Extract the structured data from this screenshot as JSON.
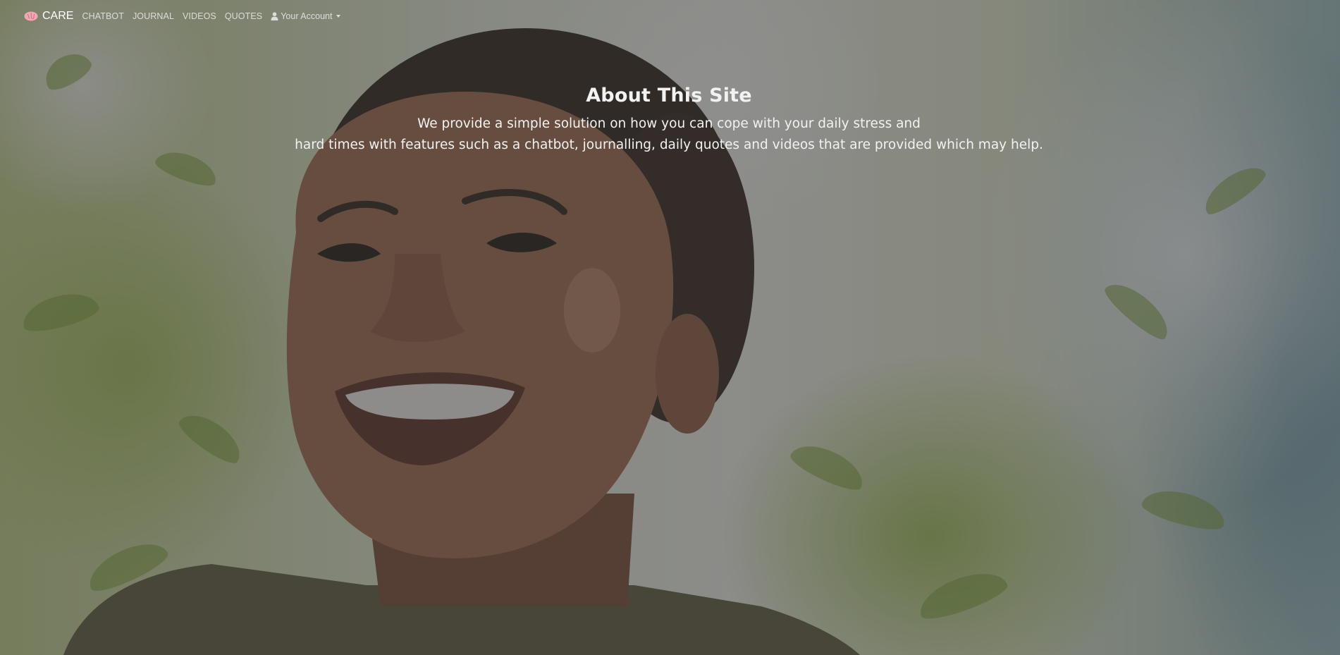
{
  "navbar": {
    "brand": {
      "icon": "brain-icon",
      "label": "CARE"
    },
    "links": [
      {
        "label": "CHATBOT"
      },
      {
        "label": "JOURNAL"
      },
      {
        "label": "VIDEOS"
      },
      {
        "label": "QUOTES"
      }
    ],
    "account": {
      "icon": "user-icon",
      "label": "Your Account",
      "dropdown_icon": "caret-down-icon"
    }
  },
  "hero": {
    "title": "About This Site",
    "lines": [
      "We provide a simple solution on how you can cope with your daily stress and",
      "hard times with features such as a chatbot, journalling, daily quotes and videos that are provided which may help."
    ]
  },
  "colors": {
    "overlay": "#373737",
    "text": "#f2f2f2",
    "brand_icon": "#f2a7b3"
  }
}
